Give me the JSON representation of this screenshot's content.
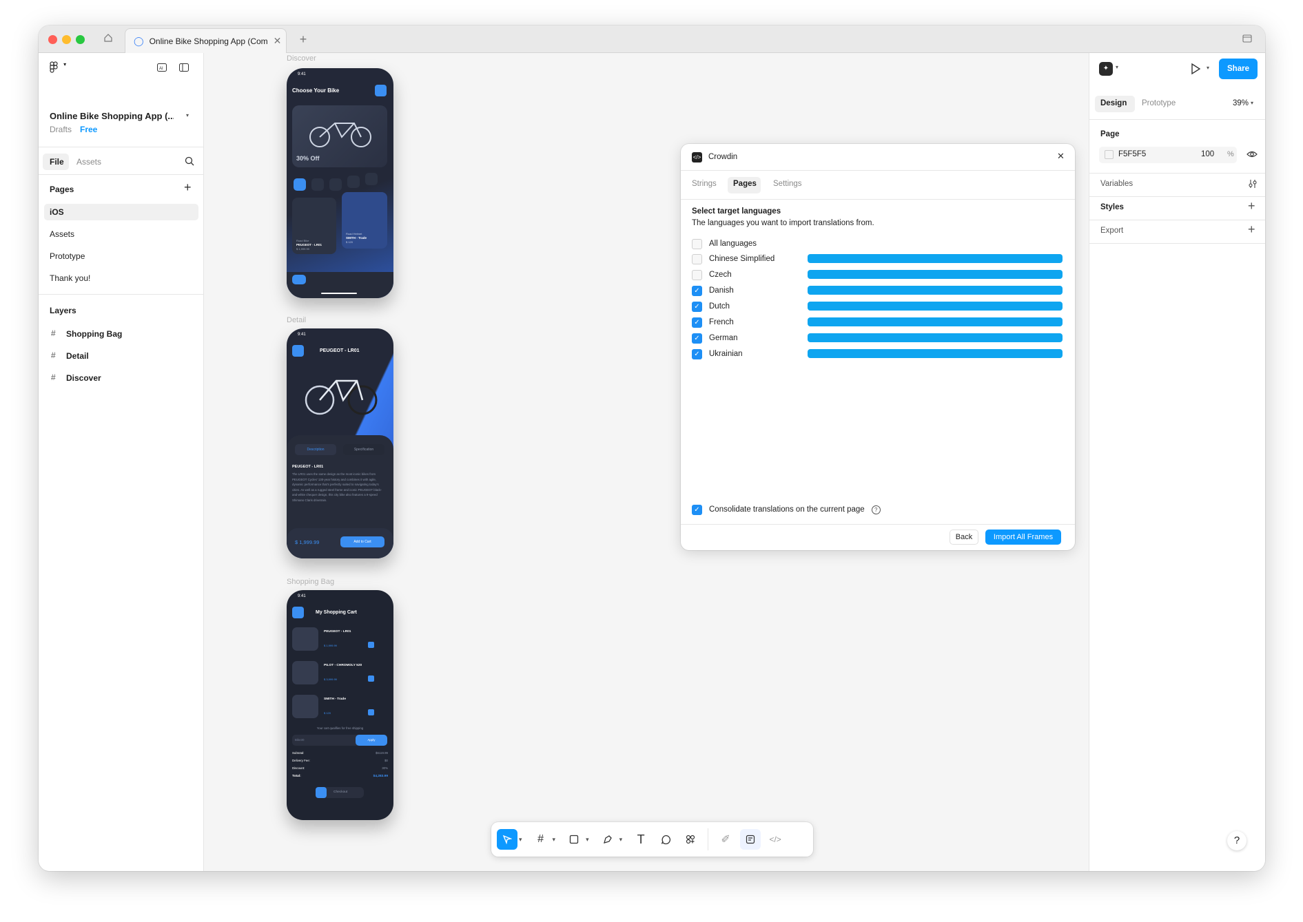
{
  "tab": {
    "title": "Online Bike Shopping App (Community)"
  },
  "left": {
    "file_name": "Online Bike Shopping App (...",
    "drafts": "Drafts",
    "plan": "Free",
    "tabs": [
      "File",
      "Assets"
    ],
    "pages_heading": "Pages",
    "pages": [
      "iOS",
      "Assets",
      "Prototype",
      "Thank you!"
    ],
    "layers_heading": "Layers",
    "layers": [
      "Shopping Bag",
      "Detail",
      "Discover"
    ]
  },
  "canvas": {
    "frames": [
      "Discover",
      "Detail",
      "Shopping Bag"
    ],
    "discover": {
      "time": "9:41",
      "title": "Choose Your Bike",
      "promo": "30% Off",
      "card1_name": "PEUGEOT - LR01",
      "card1_type": "Road Bike",
      "card1_price": "$ 1,999.99",
      "card2_name": "SMITH - Trade",
      "card2_type": "Road Helmet",
      "card2_price": "$ 120"
    },
    "detail": {
      "time": "9:41",
      "title": "PEUGEOT - LR01",
      "tab1": "Description",
      "tab2": "Specification",
      "heading": "PEUGEOT - LR01",
      "body": "The LR01 uses the same design as the most iconic bikes from PEUGEOT Cycles' 130-year history and combines it with agile, dynamic performance that's perfectly suited to navigating today's cities. As well as a rugged steel frame and iconic PEUGEOT black-and-white chequer design, this city bike also features a 9-speed Shimano Claris drivetrain.",
      "price": "$ 1,999.99",
      "cta": "Add to Cart"
    },
    "bag": {
      "time": "9:41",
      "title": "My Shopping Cart",
      "items": [
        {
          "name": "PEUGEOT - LR01",
          "price": "$ 1,999.99"
        },
        {
          "name": "PILOT - CHROMOLY 520",
          "price": "$ 3,999.99"
        },
        {
          "name": "SMITH - Trade",
          "price": "$ 120"
        }
      ],
      "free_ship": "Your cart qualifies for free shipping",
      "coupon_ph": "Bike30",
      "apply": "Apply",
      "subtotal_label": "Subtotal:",
      "subtotal": "$6119.99",
      "delivery_label": "Delivery Fee:",
      "delivery": "$0",
      "discount_label": "Discount:",
      "discount": "30%",
      "total_label": "Total:",
      "total": "$4,283.99",
      "checkout": "Checkout"
    }
  },
  "plugin": {
    "name": "Crowdin",
    "tabs": [
      "Strings",
      "Pages",
      "Settings"
    ],
    "active_tab": "Pages",
    "heading": "Select target languages",
    "subheading": "The languages you want to import translations from.",
    "all_label": "All languages",
    "languages": [
      {
        "name": "Chinese Simplified",
        "checked": false,
        "progress": 1.0
      },
      {
        "name": "Czech",
        "checked": false,
        "progress": 1.0
      },
      {
        "name": "Danish",
        "checked": true,
        "progress": 1.0
      },
      {
        "name": "Dutch",
        "checked": true,
        "progress": 1.0
      },
      {
        "name": "French",
        "checked": true,
        "progress": 1.0
      },
      {
        "name": "German",
        "checked": true,
        "progress": 1.0
      },
      {
        "name": "Ukrainian",
        "checked": true,
        "progress": 1.0
      }
    ],
    "consolidate": "Consolidate translations on the current page",
    "back": "Back",
    "import": "Import All Frames"
  },
  "right": {
    "share": "Share",
    "tabs": [
      "Design",
      "Prototype"
    ],
    "zoom": "39%",
    "page_heading": "Page",
    "bg_hex": "F5F5F5",
    "bg_opacity": "100",
    "pct": "%",
    "variables": "Variables",
    "styles": "Styles",
    "export": "Export"
  },
  "colors": {
    "accent": "#0d99ff",
    "progress": "#0ea5f0",
    "canvas": "#f5f5f5",
    "phone": "#1f2431",
    "phone_blue": "#3b7bf2"
  },
  "help": "?"
}
